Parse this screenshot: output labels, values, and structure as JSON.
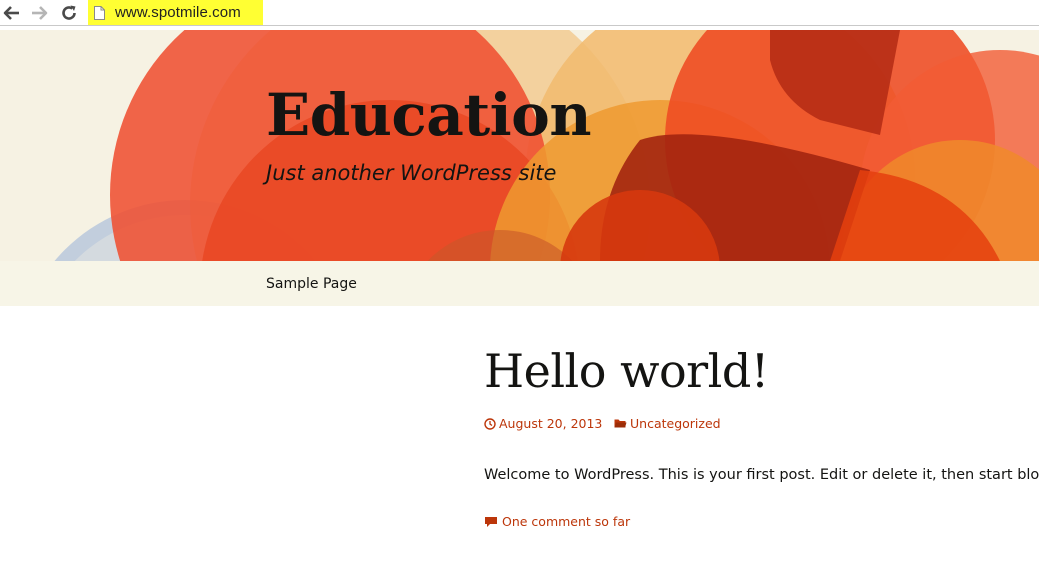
{
  "browser": {
    "url": "www.spotmile.com",
    "highlight_color": "#ffff33"
  },
  "site": {
    "title": "Education",
    "description": "Just another WordPress site"
  },
  "nav": {
    "items": [
      {
        "label": "Sample Page"
      }
    ]
  },
  "post": {
    "title": "Hello world!",
    "date": "August 20, 2013",
    "category": "Uncategorized",
    "body": "Welcome to WordPress. This is your first post. Edit or delete it, then start blogging!",
    "comments_link": "One comment so far"
  },
  "colors": {
    "link": "#bc360a",
    "text": "#141412",
    "nav_background": "#f7f5e7",
    "header_background": "#f6f2e3"
  },
  "icons": {
    "back": "arrow-left-icon",
    "forward": "arrow-right-icon",
    "reload": "reload-icon",
    "page": "page-icon",
    "date": "clock-icon",
    "category": "folder-icon",
    "comment": "comment-bubble-icon"
  }
}
